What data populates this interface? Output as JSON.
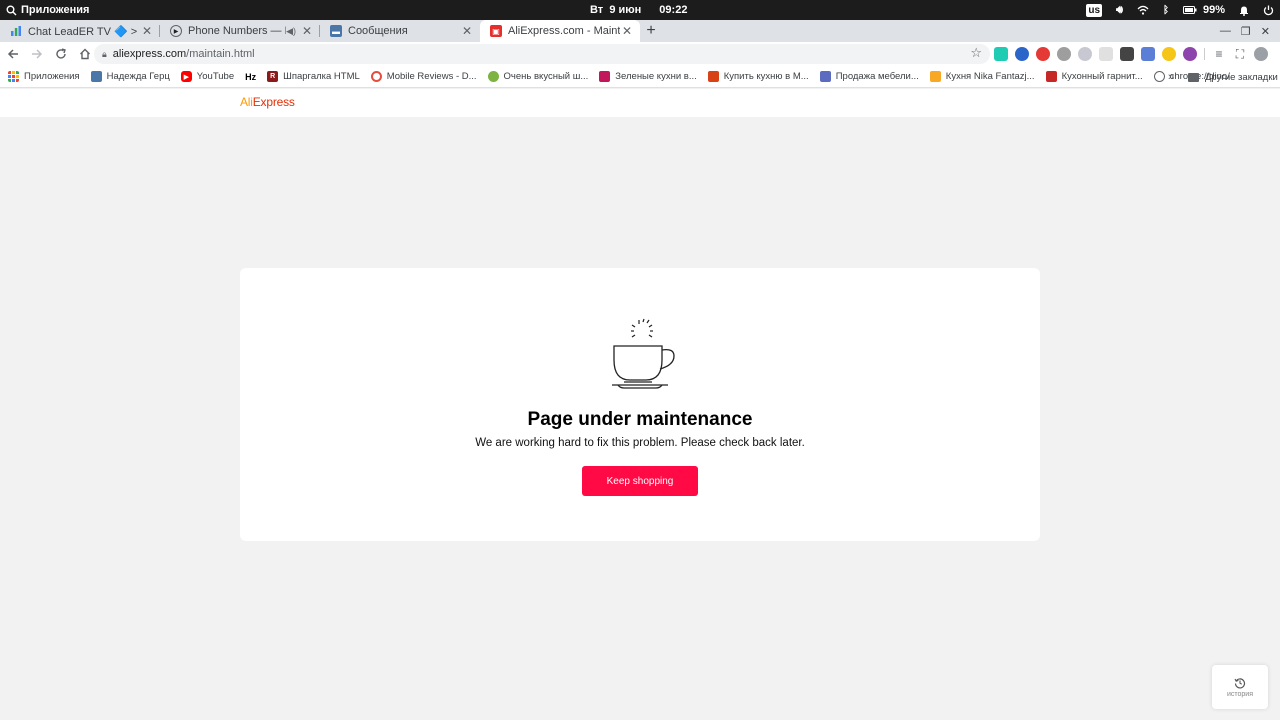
{
  "os_bar": {
    "apps_label": "Приложения",
    "day": "Вт",
    "date": "9 июн",
    "time": "09:22",
    "keyboard_layout": "us",
    "battery": "99%"
  },
  "tabs": [
    {
      "title": "Chat LeadER TV 🔷 > Users | C",
      "color": "#3b7bd8",
      "active": false
    },
    {
      "title": "Phone Numbers — Domini",
      "color": "#ffffff",
      "active": false,
      "audio": true
    },
    {
      "title": "Сообщения",
      "color": "#4a76a8",
      "active": false
    },
    {
      "title": "AliExpress.com - Maintaining",
      "color": "#e62e2d",
      "active": true
    }
  ],
  "address_bar": {
    "host": "aliexpress.com",
    "path": "/maintain.html"
  },
  "bookmarks": [
    {
      "label": "Приложения",
      "color": "#e8710a"
    },
    {
      "label": "Надежда Герц",
      "color": "#4a76a8"
    },
    {
      "label": "YouTube",
      "color": "#ff0000"
    },
    {
      "label": "Hz",
      "color": "#ffffff"
    },
    {
      "label": "Шпаргалка HTML",
      "color": "#8b1a1a"
    },
    {
      "label": "Mobile Reviews - D...",
      "color": "#e74c3c"
    },
    {
      "label": "Очень вкусный ш...",
      "color": "#7cb342"
    },
    {
      "label": "Зеленые кухни в...",
      "color": "#c2185b"
    },
    {
      "label": "Купить кухню в М...",
      "color": "#d84315"
    },
    {
      "label": "Продажа мебели...",
      "color": "#5c6bc0"
    },
    {
      "label": "Кухня Nika Fantazj...",
      "color": "#f9a825"
    },
    {
      "label": "Кухонный гарнит...",
      "color": "#c62828"
    },
    {
      "label": "chrome://dino/",
      "color": "#5f6368"
    }
  ],
  "bookmarks_more": "»",
  "bookmarks_other": "Другие закладки",
  "logo": {
    "part1": "Ali",
    "part2": "Express"
  },
  "maintenance": {
    "title": "Page under maintenance",
    "subtitle": "We are working hard to fix this problem. Please check back later.",
    "button_label": "Keep shopping",
    "button_color": "#ff0a45"
  },
  "history_widget": {
    "label": "история"
  }
}
